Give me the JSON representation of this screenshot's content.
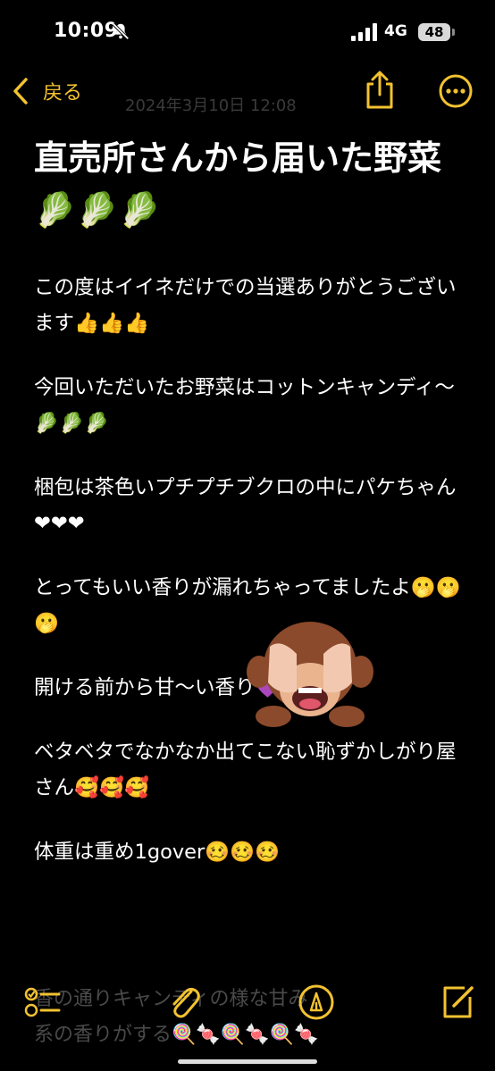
{
  "status_bar": {
    "time": "10:09",
    "network": "4G",
    "battery": "48"
  },
  "nav": {
    "back_label": "戻る",
    "date_ghost": "2024年3月10日 12:08"
  },
  "note": {
    "title": "直売所さんから届いた野菜🥬🥬🥬",
    "paragraphs": [
      "この度はイイネだけでの当選ありがとうございます👍👍👍",
      "今回いただいたお野菜はコットンキャンディ〜🥬🥬🥬",
      "梱包は茶色いプチプチブクロの中にパケちゃん❤❤❤",
      "とってもいい香りが漏れちゃってましたよ🫢🫢🫢",
      "開ける前から甘〜い香り💜💜💜",
      "ベタベタでなかなか出てこない恥ずかしがり屋さん🥰🥰🥰",
      "体重は重め1gover🥴🥴🥴"
    ],
    "ghost_lines": [
      "香の通りキャンディの様な甘み",
      "系の香りがする🍭🍬🍭🍬🍭🍬"
    ]
  },
  "colors": {
    "accent": "#f2c230",
    "background": "#000000",
    "text": "#ffffff"
  },
  "icons": {
    "back": "chevron-left-icon",
    "share": "share-icon",
    "more": "ellipsis-circle-icon",
    "checklist": "checklist-icon",
    "attach": "paperclip-icon",
    "markup": "markup-pen-icon",
    "compose": "compose-icon",
    "sticker": "see-no-evil-monkey-memoji"
  }
}
